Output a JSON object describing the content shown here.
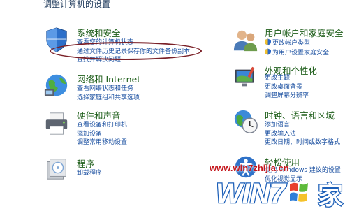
{
  "header": {
    "title": "调整计算机的设置"
  },
  "categories": {
    "system": {
      "title": "系统和安全",
      "icon": "shield-icon",
      "links": [
        "查看您的计算机状态",
        "通过文件历史记录保存你的文件备份副本",
        "查找并解决问题"
      ]
    },
    "user": {
      "title": "用户帐户和家庭安全",
      "icon": "users-icon",
      "links": [
        "更改帐户类型",
        "为用户设置家庭安全"
      ]
    },
    "network": {
      "title": "网络和 Internet",
      "icon": "network-globe-icon",
      "links": [
        "查看网络状态和任务",
        "选择家庭组和共享选项"
      ]
    },
    "appearance": {
      "title": "外观和个性化",
      "icon": "monitor-paint-icon",
      "links": [
        "更改主题",
        "更改桌面背景",
        "调整屏幕分辨率"
      ]
    },
    "hardware": {
      "title": "硬件和声音",
      "icon": "printer-icon",
      "links": [
        "查看设备和打印机",
        "添加设备",
        "调整常用移动设置"
      ]
    },
    "clock": {
      "title": "时钟、语言和区域",
      "icon": "clock-globe-icon",
      "links": [
        "添加语言",
        "更改输入法",
        "更改日期、时间或数字格式"
      ]
    },
    "programs": {
      "title": "程序",
      "icon": "programs-icon",
      "links": [
        "卸载程序"
      ]
    },
    "ease": {
      "title": "轻松使用",
      "icon": "ease-of-access-icon",
      "links": [
        "使用 Windows 建议的设置",
        "优化视觉显示"
      ]
    }
  },
  "watermark": {
    "url": "www.win7zhijia.cn",
    "logo_text": "WIN7",
    "logo_suffix": "家"
  },
  "colors": {
    "title_green": "#1e5e1a",
    "link_blue": "#1a4fa0",
    "highlight_oval": "#7a1f26",
    "watermark_red": "#c4161c",
    "watermark_blue": "#1c5fb8"
  }
}
